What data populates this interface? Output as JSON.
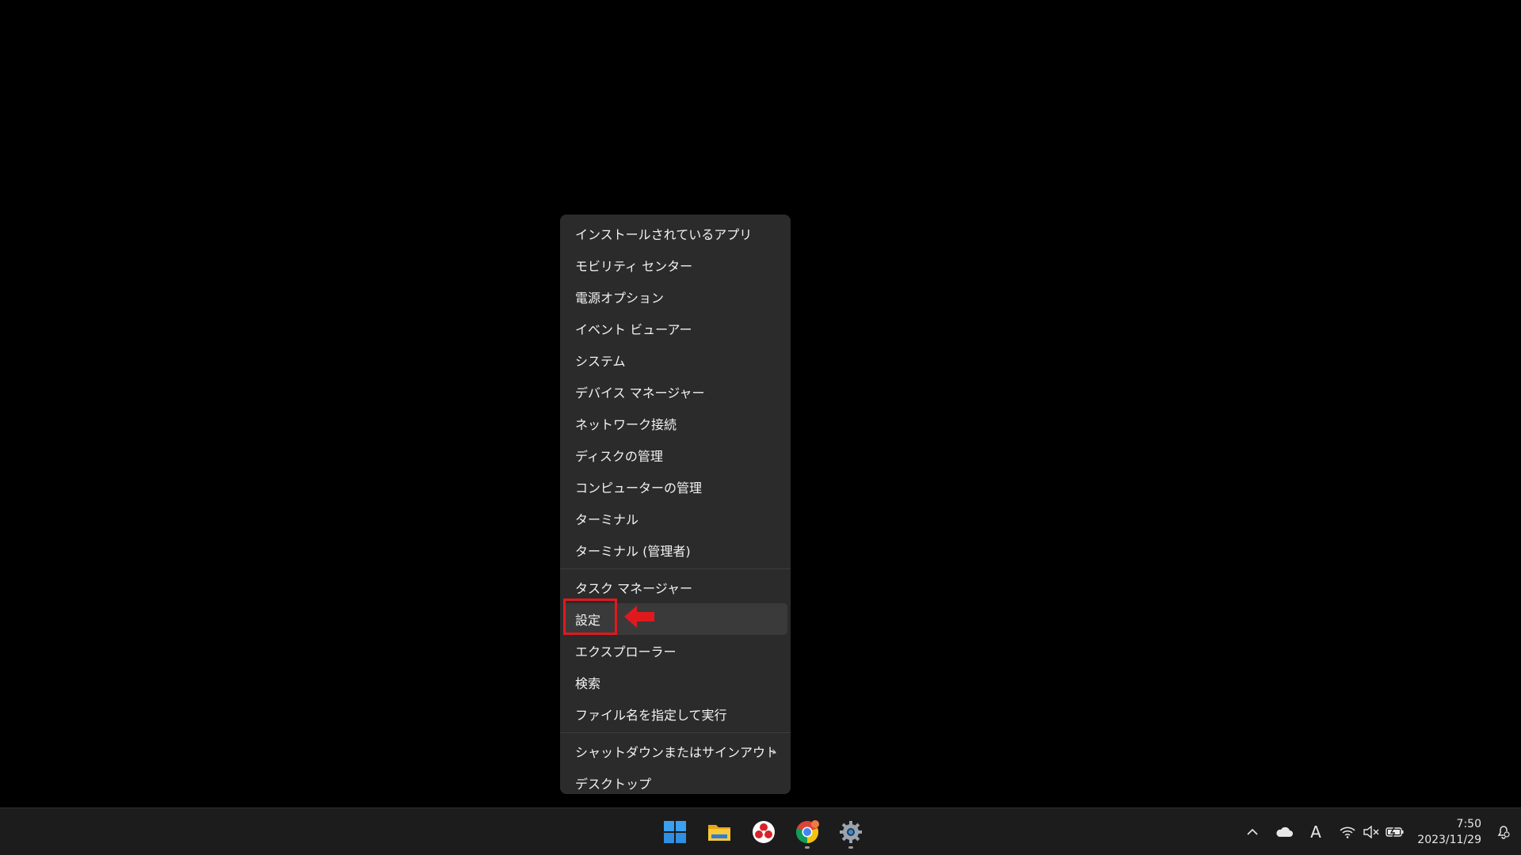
{
  "menu": {
    "groups": [
      [
        "インストールされているアプリ",
        "モビリティ センター",
        "電源オプション",
        "イベント ビューアー",
        "システム",
        "デバイス マネージャー",
        "ネットワーク接続",
        "ディスクの管理",
        "コンピューターの管理",
        "ターミナル",
        "ターミナル (管理者)"
      ],
      [
        "タスク マネージャー",
        "設定",
        "エクスプローラー",
        "検索",
        "ファイル名を指定して実行"
      ],
      [
        "シャットダウンまたはサインアウト",
        "デスクトップ"
      ]
    ],
    "highlighted_item": "設定",
    "submenu_chevron": "›"
  },
  "annotation": {
    "highlight_color": "#e0191f"
  },
  "taskbar": {
    "apps": [
      "start-button",
      "file-explorer",
      "photos-app",
      "chrome",
      "settings"
    ],
    "tray": {
      "overflow_chevron": "^",
      "ime_indicator": "A"
    },
    "clock": {
      "time": "7:50",
      "date": "2023/11/29"
    }
  },
  "colors": {
    "menu_bg": "#2b2b2b",
    "taskbar_bg": "#1c1c1c",
    "desktop_bg": "#000000"
  }
}
